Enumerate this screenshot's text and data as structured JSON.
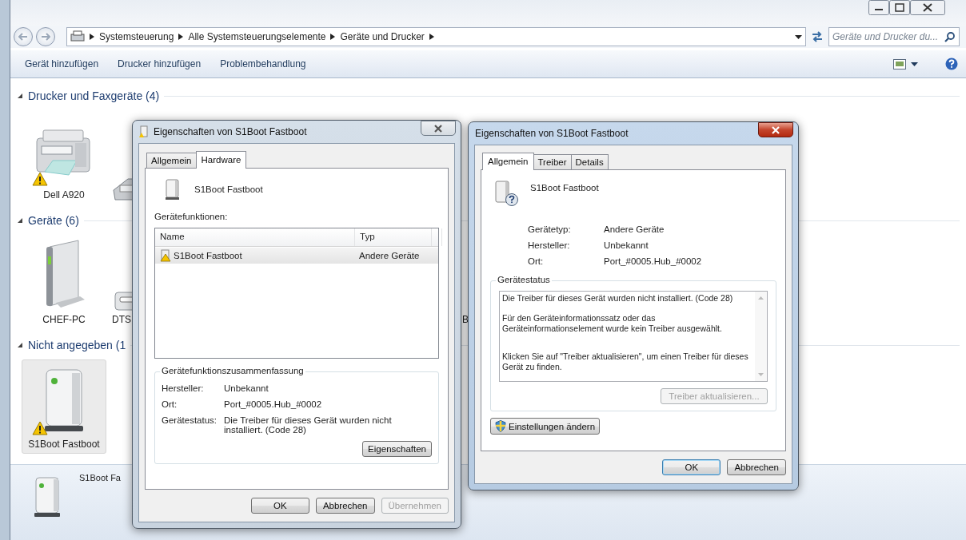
{
  "address_bar": {
    "breadcrumbs": [
      "Systemsteuerung",
      "Alle Systemsteuerungselemente",
      "Geräte und Drucker"
    ],
    "search_placeholder": "Geräte und Drucker du..."
  },
  "toolbar": {
    "buttons": [
      "Gerät hinzufügen",
      "Drucker hinzufügen",
      "Problembehandlung"
    ]
  },
  "groups": [
    {
      "title": "Drucker und Faxgeräte (4)",
      "expanded": true,
      "items": [
        {
          "label": "Dell A920",
          "kind": "printer",
          "warning": true,
          "clipped": false,
          "selected": false
        },
        {
          "kind": "fax",
          "warning": false,
          "clipped": true,
          "selected": false
        }
      ]
    },
    {
      "title": "Geräte (6)",
      "expanded": true,
      "items": [
        {
          "label": "CHEF-PC",
          "kind": "pc",
          "warning": false,
          "clipped": false,
          "selected": false
        },
        {
          "label": "DTS",
          "kind": "drive",
          "warning": false,
          "clipped": true,
          "selected": false
        },
        {
          "label": "B",
          "kind": "hidden",
          "clipped": true,
          "selected": false
        }
      ]
    },
    {
      "title": "Nicht angegeben (1",
      "expanded": true,
      "items": [
        {
          "label": "S1Boot Fastboot",
          "kind": "device",
          "warning": true,
          "clipped": false,
          "selected": true
        }
      ]
    }
  ],
  "details_pane": {
    "name": "S1Boot Fa"
  },
  "dialogs": [
    {
      "kind": "hardware",
      "title": "Eigenschaften von S1Boot Fastboot",
      "active": false,
      "tabs": [
        {
          "label": "Allgemein",
          "selected": false
        },
        {
          "label": "Hardware",
          "selected": true
        }
      ],
      "device_name": "S1Boot Fastboot",
      "functions_label": "Gerätefunktionen:",
      "table": {
        "columns": [
          "Name",
          "Typ"
        ],
        "rows": [
          {
            "name": "S1Boot Fastboot",
            "type": "Andere Geräte",
            "warning": true,
            "selected": true
          }
        ]
      },
      "summary": {
        "title": "Gerätefunktionszusammenfassung",
        "fields": [
          {
            "label": "Hersteller:",
            "value": "Unbekannt"
          },
          {
            "label": "Ort:",
            "value": "Port_#0005.Hub_#0002"
          },
          {
            "label": "Gerätestatus:",
            "value": "Die Treiber für dieses Gerät wurden nicht installiert. (Code 28)"
          }
        ],
        "button": "Eigenschaften"
      },
      "buttons": [
        {
          "label": "OK",
          "disabled": false,
          "default": false
        },
        {
          "label": "Abbrechen",
          "disabled": false,
          "default": false
        },
        {
          "label": "Übernehmen",
          "disabled": true,
          "default": false
        }
      ]
    },
    {
      "kind": "general",
      "title": "Eigenschaften von S1Boot Fastboot",
      "active": true,
      "tabs": [
        {
          "label": "Allgemein",
          "selected": true
        },
        {
          "label": "Treiber",
          "selected": false
        },
        {
          "label": "Details",
          "selected": false
        }
      ],
      "device_name": "S1Boot Fastboot",
      "fields": [
        {
          "label": "Gerätetyp:",
          "value": "Andere Geräte"
        },
        {
          "label": "Hersteller:",
          "value": "Unbekannt"
        },
        {
          "label": "Ort:",
          "value": "Port_#0005.Hub_#0002"
        }
      ],
      "status": {
        "title": "Gerätestatus",
        "paragraphs": [
          "Die Treiber für dieses Gerät wurden nicht installiert. (Code 28)",
          "Für den Geräteinformationssatz oder das Geräteinformationselement wurde kein Treiber ausgewählt.",
          "Klicken Sie auf \"Treiber aktualisieren\", um einen Treiber für dieses Gerät zu finden."
        ],
        "button": {
          "label": "Treiber aktualisieren...",
          "disabled": true
        }
      },
      "settings_button": "Einstellungen ändern",
      "buttons": [
        {
          "label": "OK",
          "disabled": false,
          "default": true
        },
        {
          "label": "Abbrechen",
          "disabled": false,
          "default": false
        }
      ]
    }
  ]
}
